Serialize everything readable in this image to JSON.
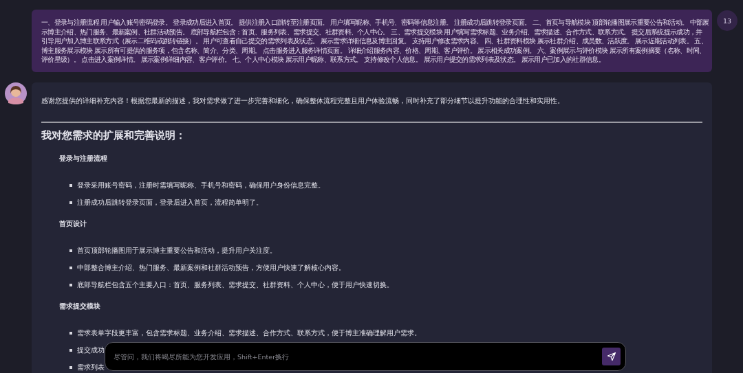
{
  "user_message": {
    "lines": [
      "一、登录与注册流程 用户输入账号密码登录。 登录成功后进入首页。 提供注册入口跳转至注册页面。 用户填写昵称、手机号、密码等信息注册。 注册成功后跳转登录页面。 二、首页与导航模块 顶部轮播图展示重要公告和活动。 中部展",
      "示博主介绍、热门服务、最新案例、社群活动预告。 底部导航栏包含：首页、服务列表、需求提交、社群资料、个人中心。 三、需求提交模块 用户填写需求标题、业务介绍、需求描述、合作方式、联系方式。 提交后系统提示成功，并",
      "引导用户加入博主联系方式（展示二维码或跳转链接）。 用户可查看自己提交的需求列表及状态。 展示需求详细信息及博主回复。 支持用户修改需求内容。 四、社群资料模块 展示社群介绍、成员数、活跃度。 展示近期活动列表。 五、",
      "博主服务展示模块 展示所有可提供的服务项，包含名称、简介、分类、周期。 点击服务进入服务详情页面。 详细介绍服务内容、价格、周期、客户评价。 展示相关成功案例。 六、案例展示与评价模块 展示所有案例摘要（名称、时间、",
      "评价星级）。 点击进入案例详情。 展示案例详细内容、客户评价。 七、个人中心模块 展示用户昵称、联系方式。 支持修改个人信息。 展示用户提交的需求列表及状态。 展示用户已加入的社群信息。"
    ],
    "count": "13"
  },
  "assistant": {
    "intro": "感谢您提供的详细补充内容！根据您最新的描述，我对需求做了进一步完善和细化，确保整体流程完整且用户体验流畅，同时补充了部分细节以提升功能的合理性和实用性。",
    "heading": "我对您需求的扩展和完善说明：",
    "sections": [
      {
        "title": "登录与注册流程",
        "items": [
          "登录采用账号密码，注册时需填写昵称、手机号和密码，确保用户身份信息完整。",
          "注册成功后跳转登录页面，登录后进入首页，流程简单明了。"
        ]
      },
      {
        "title": "首页设计",
        "items": [
          "首页顶部轮播图用于展示博主重要公告和活动，提升用户关注度。",
          "中部整合博主介绍、热门服务、最新案例和社群活动预告，方便用户快速了解核心内容。",
          "底部导航栏包含五个主要入口：首页、服务列表、需求提交、社群资料、个人中心，便于用户快速切换。"
        ]
      },
      {
        "title": "需求提交模块",
        "items": [
          "需求表单字段更丰富，包含需求标题、业务介绍、需求描述、合作方式、联系方式，便于博主准确理解用户需求。",
          "提交成功",
          "需求列表"
        ]
      }
    ]
  },
  "input": {
    "placeholder": "尽管问，我们将竭尽所能为您开发应用，Shift+Enter换行"
  }
}
